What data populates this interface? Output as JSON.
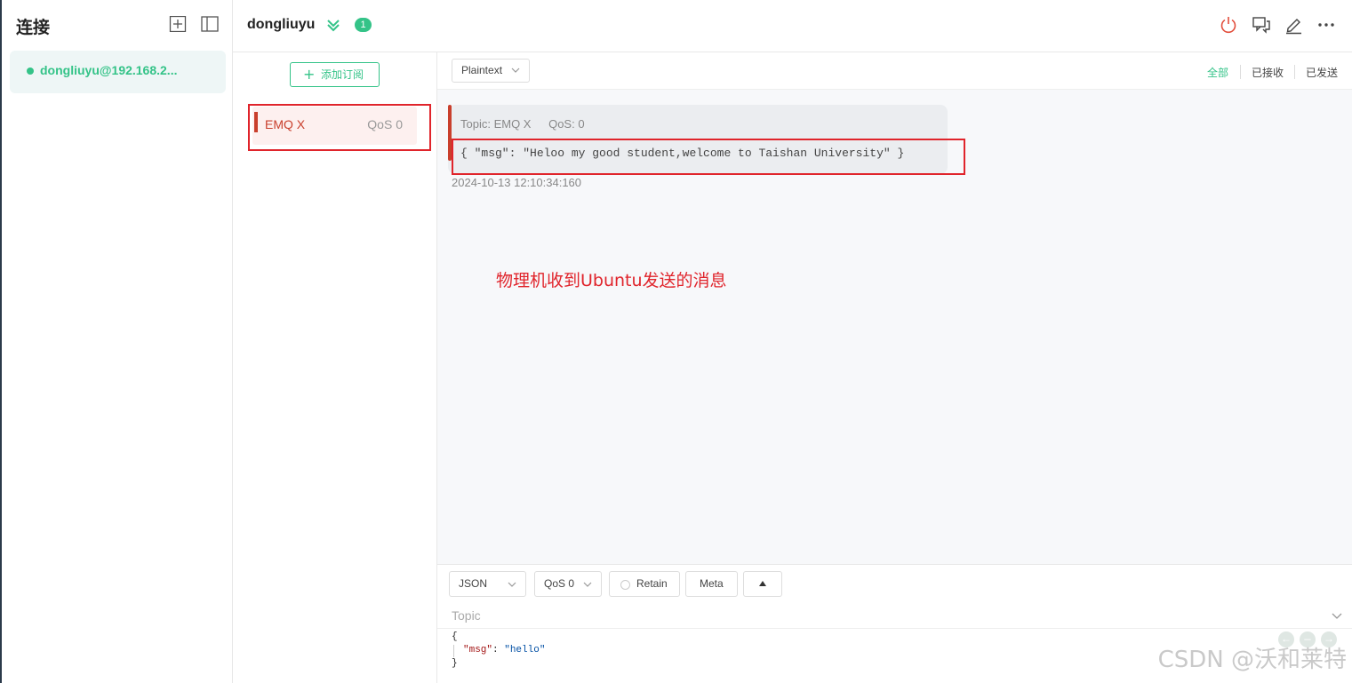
{
  "sidebar": {
    "title": "连接",
    "connection": {
      "label": "dongliuyu@192.168.2...",
      "status_color": "#34c388"
    }
  },
  "header": {
    "name": "dongliuyu",
    "badge": "1"
  },
  "subscriptions": {
    "add_label": "添加订阅",
    "items": [
      {
        "topic": "EMQ X",
        "qos": "QoS 0",
        "color": "#c93f2c"
      }
    ]
  },
  "toolbar": {
    "format": "Plaintext",
    "filters": {
      "all": "全部",
      "received": "已接收",
      "sent": "已发送"
    }
  },
  "message": {
    "topic": "Topic: EMQ X",
    "qos": "QoS: 0",
    "payload": "{ \"msg\": \"Heloo my good student,welcome to Taishan University\" }",
    "time": "2024-10-13 12:10:34:160"
  },
  "annotation": "物理机收到Ubuntu发送的消息",
  "compose": {
    "format": "JSON",
    "qos": "QoS 0",
    "retain": "Retain",
    "meta": "Meta",
    "topic_placeholder": "Topic",
    "editor": {
      "line1": "{",
      "key": "\"msg\"",
      "colon": ": ",
      "value": "\"hello\"",
      "line3": "}"
    }
  },
  "watermark": "CSDN @沃和莱特",
  "icons": {
    "sb_add": "add-square-icon",
    "sb_toggle": "sidebar-toggle-icon",
    "expand": "double-chevron-down-icon",
    "power": "power-icon",
    "chat": "chat-icon",
    "edit": "edit-icon",
    "more": "more-icon"
  },
  "colors": {
    "accent": "#34c388",
    "danger": "#e0242b",
    "sub_accent": "#c93f2c"
  }
}
